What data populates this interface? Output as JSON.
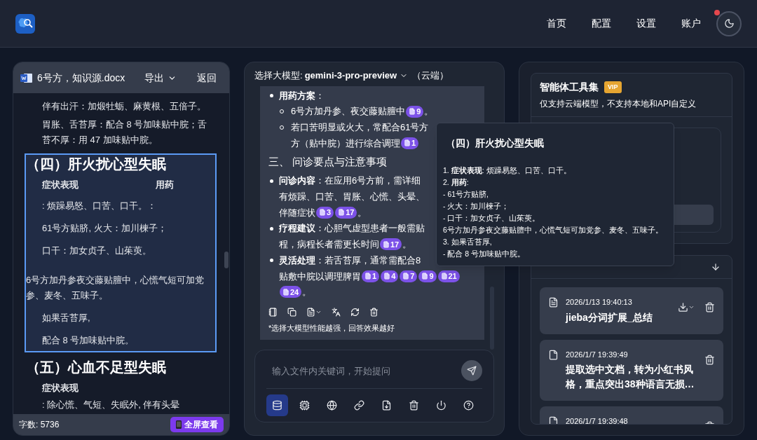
{
  "header": {
    "nav": [
      {
        "label": "首页"
      },
      {
        "label": "配置"
      },
      {
        "label": "设置"
      },
      {
        "label": "账户"
      }
    ],
    "alert": true
  },
  "document": {
    "file_name": "6号方，知识源.docx",
    "export_label": "导出",
    "back_label": "返回",
    "blocks": [
      {
        "selected": false,
        "lines": [
          {
            "kind": "indent",
            "text": "伴有出汗：加煅牡蛎、麻黄根、五倍子。"
          },
          {
            "kind": "indent",
            "text": "胃胀、舌苔厚：配合 8 号加味贴中脘；舌苔不厚：用 47 加味贴中脘。"
          }
        ]
      },
      {
        "selected": true,
        "heading": "（四）肝火扰心型失眠",
        "lines": [
          {
            "kind": "pair",
            "text": "症状表现",
            "text2": "用药"
          },
          {
            "kind": "indent",
            "text": ": 烦躁易怒、口苦、口干。："
          },
          {
            "kind": "indent",
            "text": "61号方贴脐, 火大：加川楝子；"
          },
          {
            "kind": "indent",
            "text": "口干：加女贞子、山茱萸。"
          },
          {
            "kind": "flush",
            "text": "6号方加丹参夜交藤贴膻中，心慌气短可加党参、麦冬、五味子。"
          },
          {
            "kind": "indent",
            "text": "如果舌苔厚,"
          },
          {
            "kind": "indent",
            "text": "配合 8 号加味贴中脘。"
          }
        ]
      },
      {
        "selected": false,
        "heading": "（五）心血不足型失眠",
        "lines": [
          {
            "kind": "label",
            "text": "症状表现"
          },
          {
            "kind": "indent",
            "text": ": 除心慌、气短、失眠外, 伴有头晕"
          }
        ]
      }
    ],
    "word_count": "字数: 5736",
    "fullscreen_label": "全屏查看"
  },
  "chat": {
    "model_label": "选择大模型:",
    "model": "gemini-3-pro-preview",
    "model_scope": "（云端）",
    "answer": [
      {
        "kind": "bullet",
        "text": "**用药方案**："
      },
      {
        "kind": "sub",
        "text": "6号方加丹参、夜交藤贴膻中",
        "refs": [
          "9"
        ],
        "tail": "。"
      },
      {
        "kind": "sub",
        "text": "若口苦明显或火大，常配合61号方"
      },
      {
        "kind": "subcont",
        "text": "方（贴中脘）进行综合调理",
        "refs": [
          "1"
        ]
      },
      {
        "kind": "heading",
        "text": "三、 问诊要点与注意事项"
      },
      {
        "kind": "bullet",
        "text": "**问诊内容**：在应用6号方前，需详细"
      },
      {
        "kind": "cont",
        "text": "有烦躁、口苦、胃胀、心慌、头晕、"
      },
      {
        "kind": "cont",
        "text": "伴随症状",
        "refs": [
          "3",
          "17"
        ],
        "tail": "。"
      },
      {
        "kind": "bullet",
        "text": "**疗程建议**：心胆气虚型患者一般需贴"
      },
      {
        "kind": "cont",
        "text": "程，病程长者需更长时间",
        "refs": [
          "17"
        ],
        "tail": "。"
      },
      {
        "kind": "bullet",
        "text": "**灵活处理**：若舌苔厚，通常需配合8"
      },
      {
        "kind": "cont",
        "text": "贴敷中脘以调理脾胃",
        "refs": [
          "1",
          "4",
          "7",
          "9",
          "21"
        ]
      },
      {
        "kind": "cont",
        "refs": [
          "24"
        ],
        "tail": "。"
      }
    ],
    "note": "*选择大模型性能越强，回答效果越好",
    "input": {
      "placeholder": "输入文件内关键词，开始提问"
    },
    "tools": [
      {
        "kind": "database",
        "selected": true
      },
      {
        "kind": "chip",
        "selected": false
      },
      {
        "kind": "globe",
        "selected": false
      },
      {
        "kind": "link",
        "selected": false
      },
      {
        "kind": "file-download",
        "selected": false
      },
      {
        "kind": "trash",
        "selected": false
      },
      {
        "kind": "power",
        "selected": false
      },
      {
        "kind": "help",
        "selected": false
      }
    ]
  },
  "tooltip": {
    "title": "（四）肝火扰心型失眠",
    "lines": [
      "1. **症状表现**: 烦躁易怒、口苦、口干。",
      "2. **用药**:",
      "- 61号方贴脐,",
      "- 火大：加川楝子；",
      "- 口干：加女贞子、山茱萸。",
      "6号方加丹参夜交藤贴膻中，心慌气短可加党参、麦冬、五味子。",
      "3. 如果舌苔厚,",
      "- 配合 8 号加味贴中脘。"
    ]
  },
  "agents": {
    "title": "智能体工具集",
    "badge": "VIP",
    "subtitle": "仅支持云端模型，不支持本地和API自定义"
  },
  "history": {
    "items": [
      {
        "kind": "summary",
        "date": "2026/1/13 19:40:13",
        "title": "jieba分词扩展_总结",
        "downloadable": true
      },
      {
        "kind": "plain",
        "date": "2026/1/7 19:39:49",
        "title": "提取选中文档，转为小红书风格，重点突出38种语言无损…",
        "downloadable": false
      },
      {
        "kind": "plain",
        "date": "2026/1/7 19:39:48",
        "downloadable": false
      }
    ]
  }
}
